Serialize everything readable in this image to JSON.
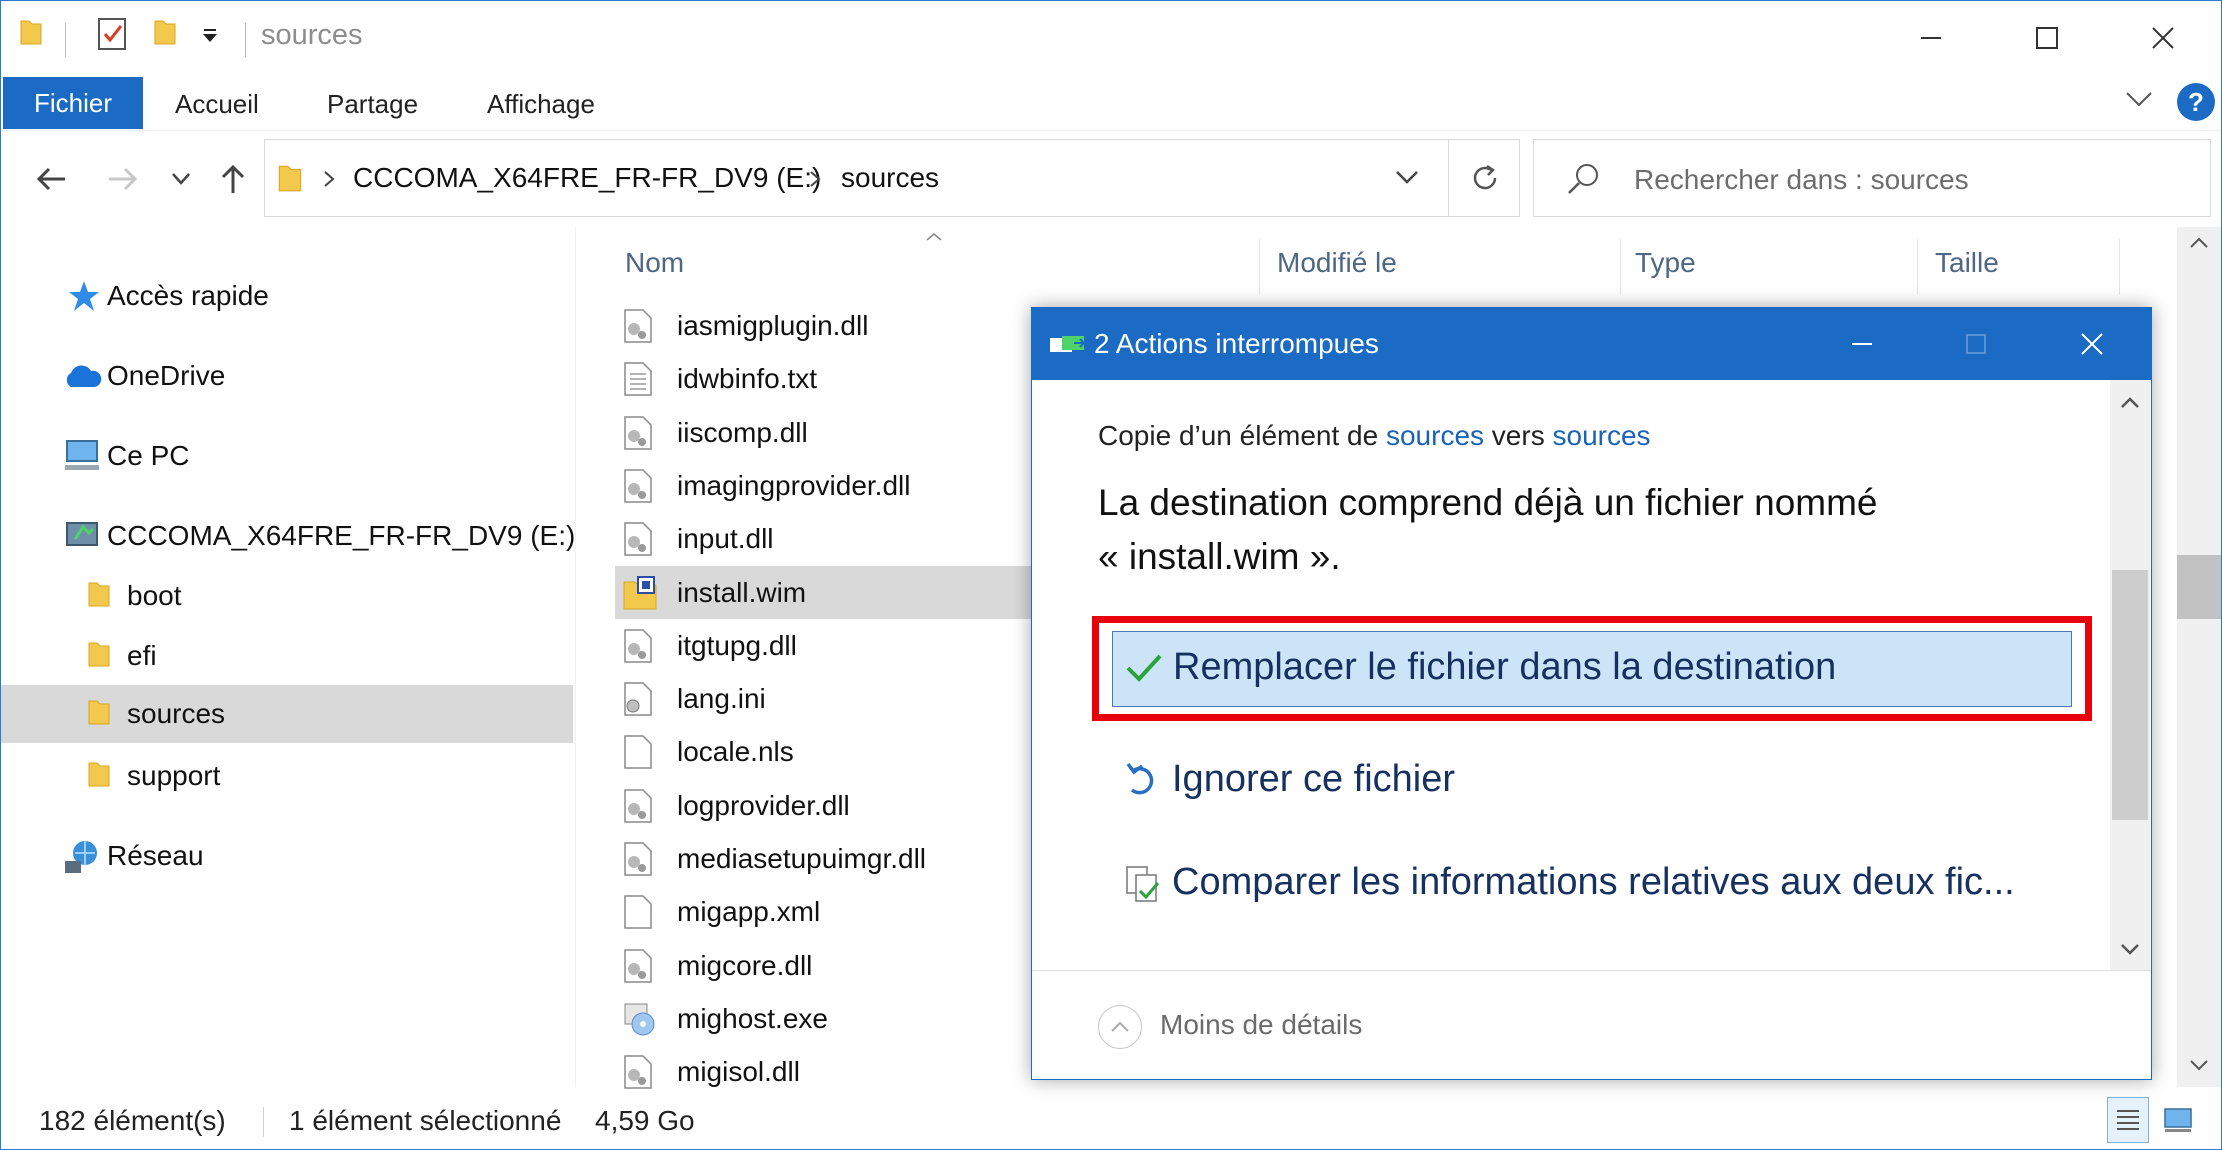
{
  "window": {
    "title": "sources",
    "quick_access": {
      "properties_icon": "checklist-icon",
      "folder_icon": "folder-icon",
      "dropdown_icon": "dropdown-arrow-icon"
    }
  },
  "ribbon": {
    "tabs": [
      "Fichier",
      "Accueil",
      "Partage",
      "Affichage"
    ],
    "help_label": "?"
  },
  "address": {
    "drive": "CCCOMA_X64FRE_FR-FR_DV9 (E:)",
    "folder": "sources"
  },
  "search": {
    "placeholder": "Rechercher dans : sources"
  },
  "navpane": {
    "items": [
      {
        "label": "Accès rapide",
        "icon": "star-icon"
      },
      {
        "label": "OneDrive",
        "icon": "cloud-icon"
      },
      {
        "label": "Ce PC",
        "icon": "computer-icon"
      },
      {
        "label": "CCCOMA_X64FRE_FR-FR_DV9 (E:)",
        "icon": "drive-icon"
      },
      {
        "label": "boot",
        "icon": "folder-icon"
      },
      {
        "label": "efi",
        "icon": "folder-icon"
      },
      {
        "label": "sources",
        "icon": "folder-icon"
      },
      {
        "label": "support",
        "icon": "folder-icon"
      },
      {
        "label": "Réseau",
        "icon": "network-icon"
      }
    ]
  },
  "filelist": {
    "columns": [
      "Nom",
      "Modifié le",
      "Type",
      "Taille"
    ],
    "files": [
      {
        "name": "iasmigplugin.dll",
        "icon": "dll-icon"
      },
      {
        "name": "idwbinfo.txt",
        "icon": "text-file-icon"
      },
      {
        "name": "iiscomp.dll",
        "icon": "dll-icon"
      },
      {
        "name": "imagingprovider.dll",
        "icon": "dll-icon"
      },
      {
        "name": "input.dll",
        "icon": "dll-icon"
      },
      {
        "name": "install.wim",
        "icon": "wim-icon"
      },
      {
        "name": "itgtupg.dll",
        "icon": "dll-icon"
      },
      {
        "name": "lang.ini",
        "icon": "ini-icon"
      },
      {
        "name": "locale.nls",
        "icon": "blank-file-icon"
      },
      {
        "name": "logprovider.dll",
        "icon": "dll-icon"
      },
      {
        "name": "mediasetupuimgr.dll",
        "icon": "dll-icon"
      },
      {
        "name": "migapp.xml",
        "icon": "blank-file-icon"
      },
      {
        "name": "migcore.dll",
        "icon": "dll-icon"
      },
      {
        "name": "mighost.exe",
        "icon": "exe-icon"
      },
      {
        "name": "migisol.dll",
        "icon": "dll-icon"
      }
    ]
  },
  "statusbar": {
    "count": "182 élément(s)",
    "selected": "1 élément sélectionné",
    "size": "4,59 Go"
  },
  "dialog": {
    "title": "2 Actions interrompues",
    "from_prefix": "Copie d’un élément de ",
    "from_link": "sources",
    "to_word": " vers ",
    "to_link": "sources",
    "message_line1": "La destination comprend déjà un fichier nommé",
    "message_line2": "« install.wim ».",
    "options": [
      {
        "label": "Remplacer le fichier dans la destination",
        "icon": "checkmark-icon"
      },
      {
        "label": "Ignorer ce fichier",
        "icon": "undo-arrow-icon"
      },
      {
        "label": "Comparer les informations relatives aux deux fic...",
        "icon": "compare-files-icon"
      }
    ],
    "footer": "Moins de détails"
  },
  "colors": {
    "accent": "#1b6ac4",
    "highlight_box": "#e8000b",
    "option_selected_bg": "#cce4f7",
    "selection_gray": "#d9d9d9",
    "link": "#1a63b8"
  }
}
